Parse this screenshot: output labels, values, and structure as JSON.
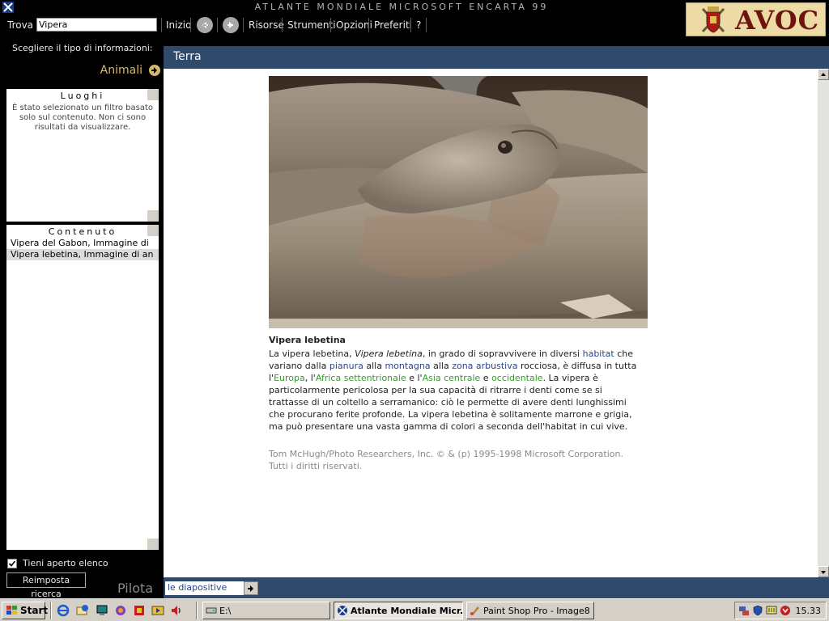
{
  "window": {
    "title": "ATLANTE MONDIALE MICROSOFT ENCARTA 99"
  },
  "menubar": {
    "find_label": "Trova",
    "find_value": "Vipera",
    "items": [
      "Inizio",
      "Risorse",
      "Strumenti",
      "Opzioni",
      "Preferiti",
      "?"
    ]
  },
  "logo": {
    "text": "AVOC"
  },
  "left_panel": {
    "choose_label": "Scegliere il tipo di informazioni:",
    "category": "Animali",
    "places": {
      "heading": "Luoghi",
      "message": "È stato selezionato un filtro basato solo sul contenuto. Non ci sono risultati da visualizzare."
    },
    "contents": {
      "heading": "Contenuto",
      "items": [
        "Vipera del Gabon, Immagine di",
        "Vipera lebetina, Immagine di an"
      ]
    },
    "keep_open_label": "Tieni aperto elenco",
    "keep_open_checked": true,
    "reset_label": "Reimposta ricerca",
    "pilot_label": "Pilota"
  },
  "main": {
    "header": "Terra",
    "caption_title": "Vipera lebetina",
    "caption": {
      "p1": "La vipera lebetina, ",
      "species": "Vipera lebetina",
      "p2": ", in grado di sopravvivere in diversi ",
      "link_habitat": "habitat",
      "p3": " che variano dalla ",
      "link_pianura": "pianura",
      "p4": " alla ",
      "link_montagna": "montagna",
      "p5": " alla ",
      "link_zona": "zona arbustiva",
      "p6": " rocciosa, è diffusa in tutta l'",
      "link_europa": "Europa",
      "p7": ", l'",
      "link_africa": "Africa settentrionale",
      "p8": " e l'",
      "link_asia": "Asia centrale",
      "p9": " e ",
      "link_occ": "occidentale",
      "p10": ". La vipera è particolarmente pericolosa per la sua capacità di ritrarre i denti come se si trattasse di un coltello a serramanico: ciò le permette di avere denti lunghissimi che procurano ferite profonde. La vipera lebetina è solitamente marrone e grigia, ma può presentare una vasta gamma di colori a seconda dell'habitat in cui vive."
    },
    "credit": "Tom McHugh/Photo Researchers, Inc. © & (p) 1995-1998 Microsoft Corporation. Tutti i diritti riservati."
  },
  "bottom": {
    "slides_label": "le diapositive"
  },
  "taskbar": {
    "start_label": "Start",
    "tasks": [
      "E:\\",
      "Atlante Mondiale Micr...",
      "Paint Shop Pro - Image8"
    ],
    "clock": "15.33"
  },
  "colors": {
    "header_bar": "#2f4a6b",
    "link_blue": "#27478a",
    "link_green": "#3a9a32",
    "category_gold": "#d6b86a"
  }
}
